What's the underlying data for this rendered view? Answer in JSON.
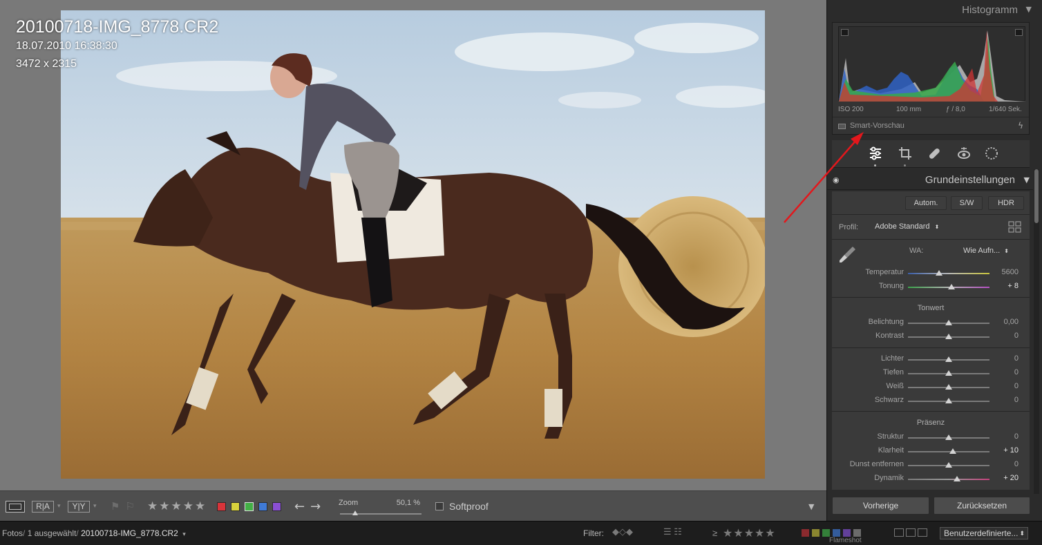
{
  "viewer": {
    "file_name": "20100718-IMG_8778.CR2",
    "capture_datetime": "18.07.2010 16:38:30",
    "dimensions": "3472 x 2315"
  },
  "toolbar": {
    "view_icon": "loupe-view-icon",
    "compare_labels": [
      "R|A",
      "Y|Y"
    ],
    "flag_icons": [
      "flag-icon",
      "reject-flag-icon"
    ],
    "stars": [
      "★",
      "★",
      "★",
      "★",
      "★"
    ],
    "color_labels": [
      "#d8343a",
      "#d8d23c",
      "#43b046",
      "#3f7ad6",
      "#8a4fd4"
    ],
    "arrows": [
      "←",
      "→"
    ],
    "zoom_label": "Zoom",
    "zoom_value": "50,1 %",
    "zoom_level": 0.19,
    "softproof_label": "Softproof"
  },
  "histogram": {
    "title": "Histogramm",
    "iso": "ISO 200",
    "focal": "100 mm",
    "aperture": "ƒ / 8,0",
    "shutter": "1/640 Sek.",
    "smart_preview": "Smart-Vorschau"
  },
  "develop": {
    "tool_icons": [
      "adjust-sliders-icon",
      "crop-icon",
      "healing-icon",
      "redeye-icon",
      "mask-icon"
    ],
    "panel_title": "Grundeinstellungen",
    "buttons": {
      "auto": "Autom.",
      "bw": "S/W",
      "hdr": "HDR"
    },
    "profile_label": "Profil:",
    "profile_value": "Adobe Standard",
    "wb_label": "WA:",
    "wb_value": "Wie Aufn...",
    "sliders_wb": [
      {
        "label": "Temperatur",
        "value": "5600",
        "pos": 0.38
      },
      {
        "label": "Tonung",
        "value": "+ 8",
        "pos": 0.53
      }
    ],
    "tonwert_title": "Tonwert",
    "sliders_tone": [
      {
        "label": "Belichtung",
        "value": "0,00",
        "pos": 0.5
      },
      {
        "label": "Kontrast",
        "value": "0",
        "pos": 0.5
      }
    ],
    "sliders_lights": [
      {
        "label": "Lichter",
        "value": "0",
        "pos": 0.5
      },
      {
        "label": "Tiefen",
        "value": "0",
        "pos": 0.5
      },
      {
        "label": "Weiß",
        "value": "0",
        "pos": 0.5
      },
      {
        "label": "Schwarz",
        "value": "0",
        "pos": 0.5
      }
    ],
    "praesenz_title": "Präsenz",
    "sliders_presence": [
      {
        "label": "Struktur",
        "value": "0",
        "pos": 0.5
      },
      {
        "label": "Klarheit",
        "value": "+ 10",
        "pos": 0.55
      },
      {
        "label": "Dunst entfernen",
        "value": "0",
        "pos": 0.5
      },
      {
        "label": "Dynamik",
        "value": "+ 20",
        "pos": 0.6
      }
    ],
    "prev_button": "Vorherige",
    "reset_button": "Zurücksetzen"
  },
  "statusbar": {
    "path_prefix": "Fotos",
    "selection": "1 ausgewählt",
    "file": "20100718-IMG_8778.CR2",
    "filter_label": "Filter:",
    "filter_ge": "≥",
    "filter_stars": "★★★★★",
    "filter_preset": "Benutzerdefinierte...",
    "overlay_text": "Flameshot"
  }
}
